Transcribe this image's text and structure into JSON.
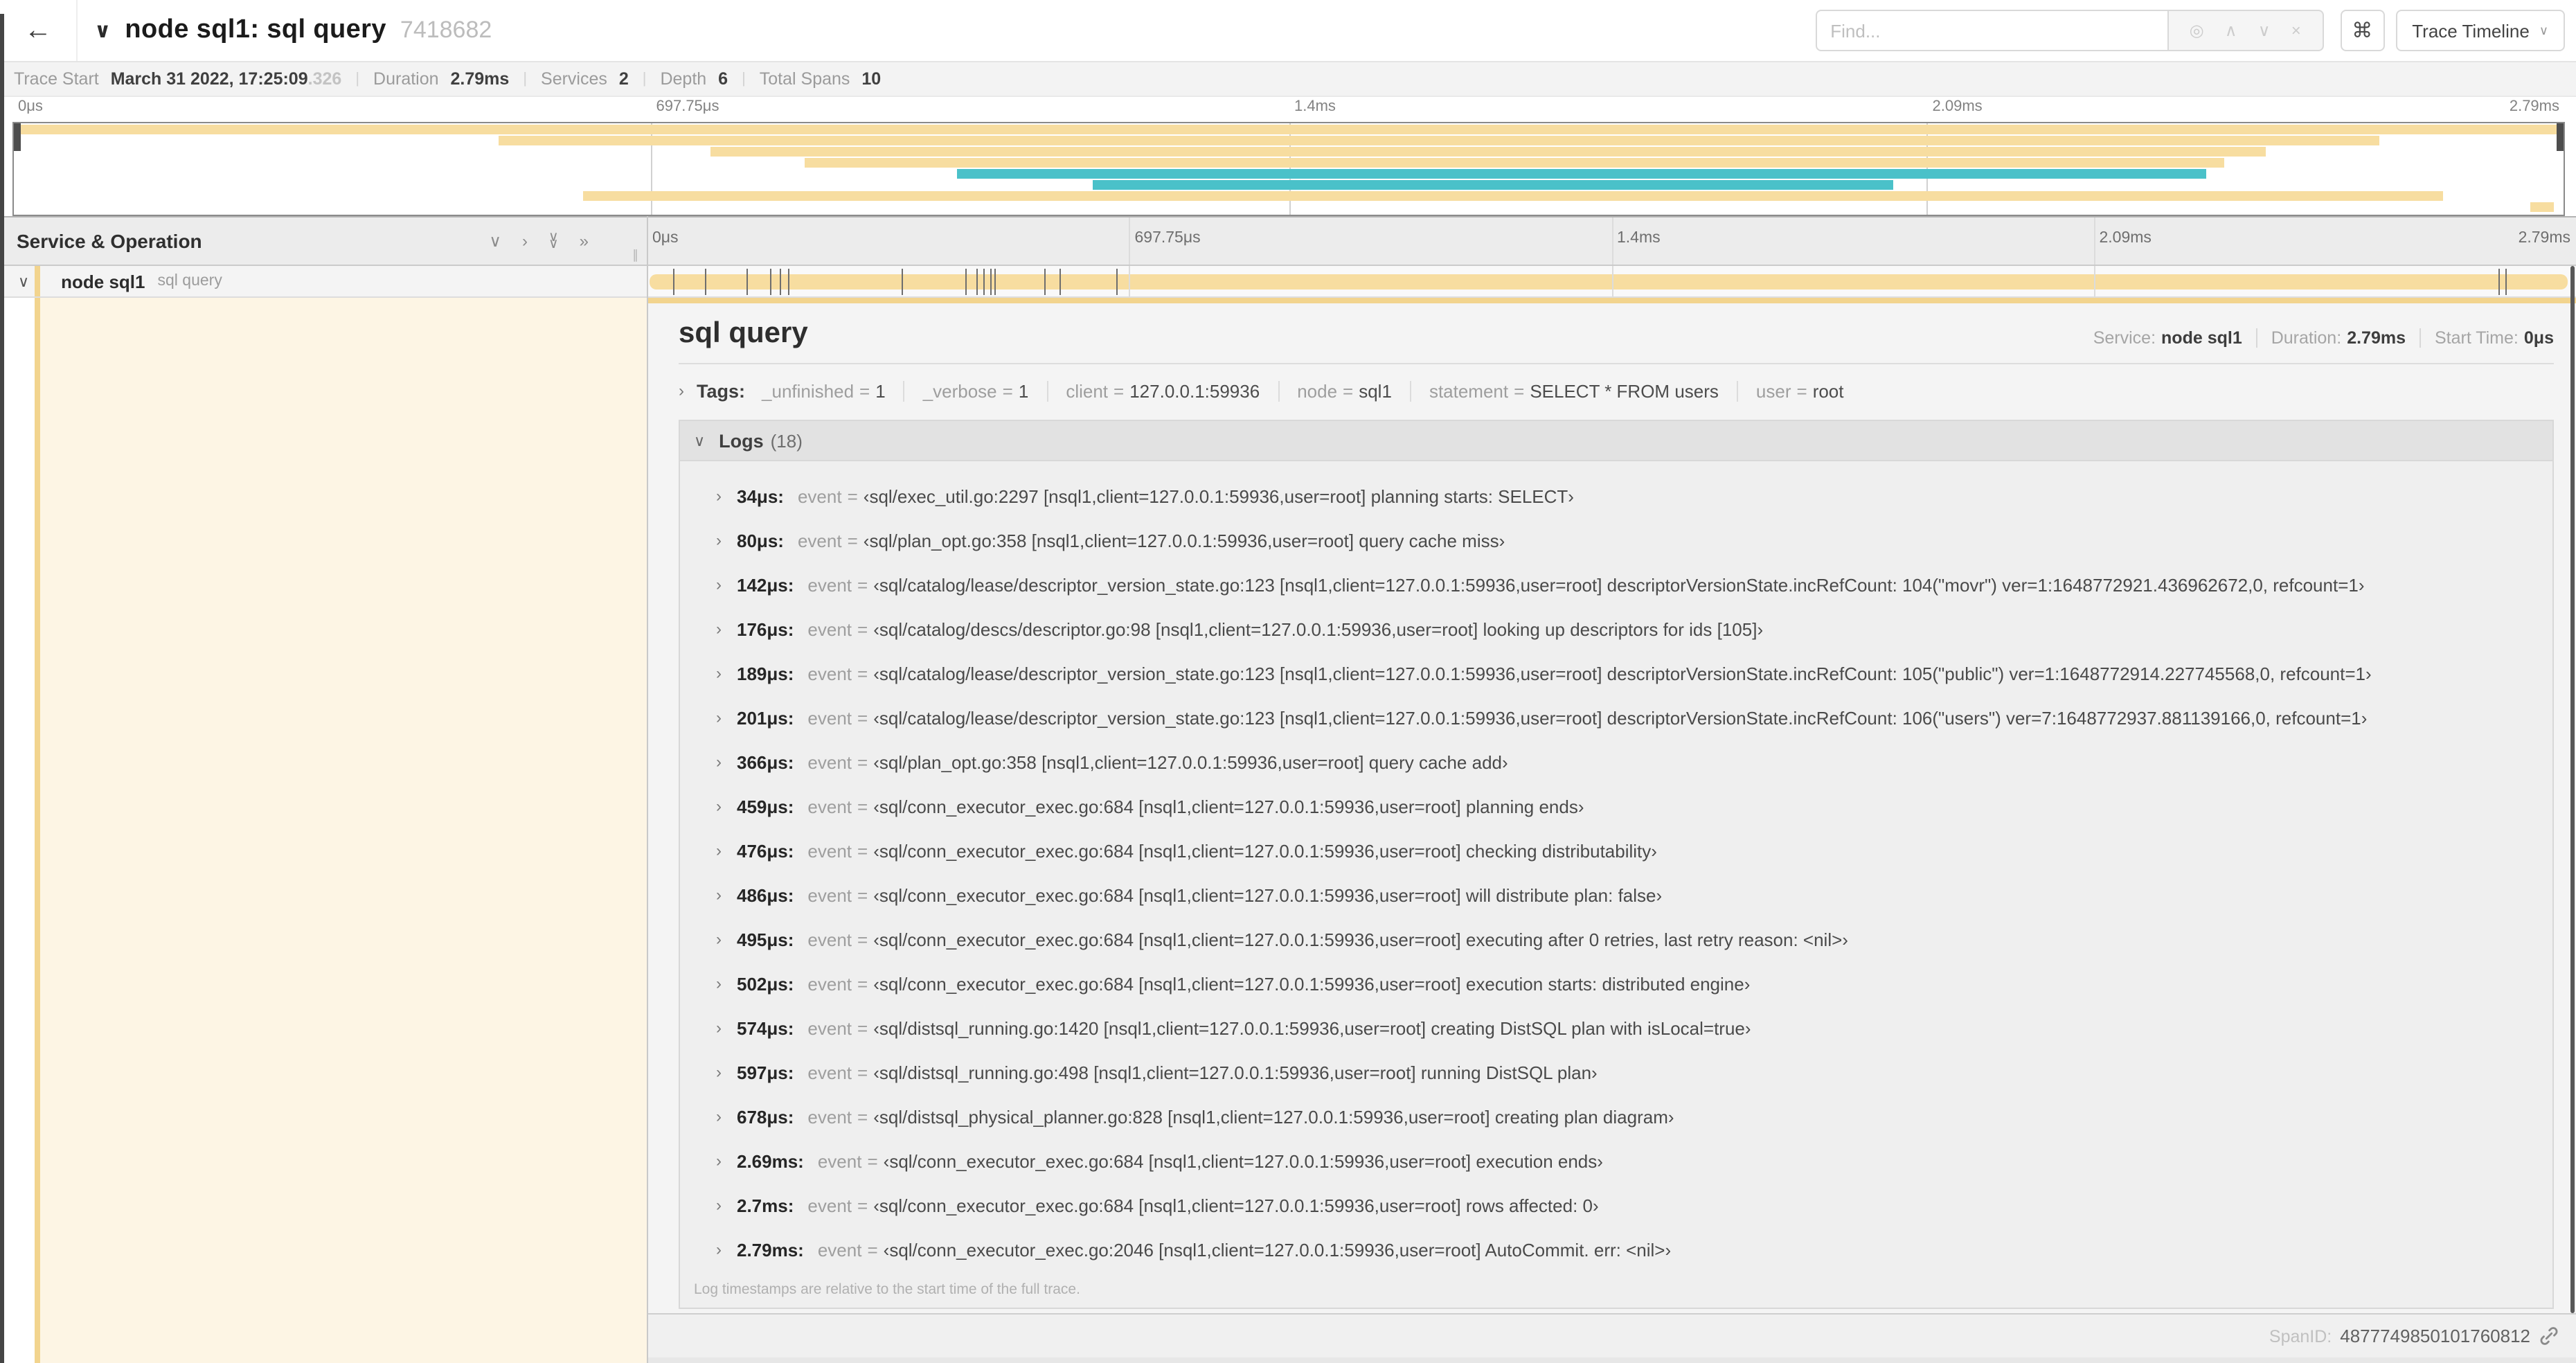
{
  "palette": {
    "span_tan": "#f7dda0",
    "span_teal": "#4ac1c9",
    "accent_tan": "#f2d48e",
    "cream": "#fdf5e4"
  },
  "icons": {
    "back": "←",
    "chevron_down": "∨",
    "chevron_right": "›",
    "double_right": "»",
    "focus": "◎",
    "prev": "∧",
    "next": "∨",
    "clear": "×",
    "shortcut": "⌘",
    "grip": "∥",
    "caret": "∨"
  },
  "header": {
    "title": "node sql1: sql query",
    "trace_id_short": "7418682",
    "find_placeholder": "Find...",
    "view_selector_label": "Trace Timeline"
  },
  "stats": [
    {
      "label": "Trace Start",
      "value": "March 31 2022, 17:25:09",
      "suffix": ".326"
    },
    {
      "label": "Duration",
      "value": "2.79ms"
    },
    {
      "label": "Services",
      "value": "2"
    },
    {
      "label": "Depth",
      "value": "6"
    },
    {
      "label": "Total Spans",
      "value": "10"
    }
  ],
  "timeline": {
    "column_header": "Service & Operation",
    "ticks": [
      "0μs",
      "697.75μs",
      "1.4ms",
      "2.09ms",
      "2.79ms"
    ],
    "tick_pcts": [
      0,
      25,
      50,
      75,
      100
    ]
  },
  "minimap": {
    "bars": [
      {
        "slot": 0,
        "start_pct": 0,
        "end_pct": 100,
        "color": "span_tan"
      },
      {
        "slot": 1,
        "start_pct": 19,
        "end_pct": 92.8,
        "color": "span_tan"
      },
      {
        "slot": 2,
        "start_pct": 27.3,
        "end_pct": 88.3,
        "color": "span_tan"
      },
      {
        "slot": 3,
        "start_pct": 31,
        "end_pct": 86.7,
        "color": "span_tan"
      },
      {
        "slot": 4,
        "start_pct": 37,
        "end_pct": 86,
        "color": "span_teal"
      },
      {
        "slot": 5,
        "start_pct": 42.3,
        "end_pct": 73.7,
        "color": "span_teal"
      },
      {
        "slot": 6,
        "start_pct": 22.3,
        "end_pct": 95.3,
        "color": "span_tan"
      },
      {
        "slot": 7,
        "start_pct": 98.7,
        "end_pct": 99.6,
        "color": "span_tan"
      }
    ]
  },
  "span_row": {
    "service": "node sql1",
    "operation": "sql query",
    "duration_us": 2790,
    "marker_us": [
      34,
      80,
      142,
      176,
      189,
      201,
      366,
      459,
      476,
      486,
      495,
      502,
      574,
      597,
      678,
      2690,
      2700
    ]
  },
  "detail": {
    "title": "sql query",
    "meta": [
      {
        "label": "Service:",
        "value": "node sql1"
      },
      {
        "label": "Duration:",
        "value": "2.79ms"
      },
      {
        "label": "Start Time:",
        "value": "0μs"
      }
    ],
    "tags_title": "Tags:",
    "tags": [
      {
        "key": "_unfinished",
        "value": "1"
      },
      {
        "key": "_verbose",
        "value": "1"
      },
      {
        "key": "client",
        "value": "127.0.0.1:59936"
      },
      {
        "key": "node",
        "value": "sql1"
      },
      {
        "key": "statement",
        "value": "SELECT * FROM users"
      },
      {
        "key": "user",
        "value": "root"
      }
    ],
    "logs_title": "Logs",
    "logs_count": "(18)",
    "logs": [
      {
        "ts": "34μs:",
        "key": "event",
        "value": "‹sql/exec_util.go:2297 [nsql1,client=127.0.0.1:59936,user=root] planning starts: SELECT›"
      },
      {
        "ts": "80μs:",
        "key": "event",
        "value": "‹sql/plan_opt.go:358 [nsql1,client=127.0.0.1:59936,user=root] query cache miss›"
      },
      {
        "ts": "142μs:",
        "key": "event",
        "value": "‹sql/catalog/lease/descriptor_version_state.go:123 [nsql1,client=127.0.0.1:59936,user=root] descriptorVersionState.incRefCount: 104(\"movr\") ver=1:1648772921.436962672,0, refcount=1›"
      },
      {
        "ts": "176μs:",
        "key": "event",
        "value": "‹sql/catalog/descs/descriptor.go:98 [nsql1,client=127.0.0.1:59936,user=root] looking up descriptors for ids [105]›"
      },
      {
        "ts": "189μs:",
        "key": "event",
        "value": "‹sql/catalog/lease/descriptor_version_state.go:123 [nsql1,client=127.0.0.1:59936,user=root] descriptorVersionState.incRefCount: 105(\"public\") ver=1:1648772914.227745568,0, refcount=1›"
      },
      {
        "ts": "201μs:",
        "key": "event",
        "value": "‹sql/catalog/lease/descriptor_version_state.go:123 [nsql1,client=127.0.0.1:59936,user=root] descriptorVersionState.incRefCount: 106(\"users\") ver=7:1648772937.881139166,0, refcount=1›"
      },
      {
        "ts": "366μs:",
        "key": "event",
        "value": "‹sql/plan_opt.go:358 [nsql1,client=127.0.0.1:59936,user=root] query cache add›"
      },
      {
        "ts": "459μs:",
        "key": "event",
        "value": "‹sql/conn_executor_exec.go:684 [nsql1,client=127.0.0.1:59936,user=root] planning ends›"
      },
      {
        "ts": "476μs:",
        "key": "event",
        "value": "‹sql/conn_executor_exec.go:684 [nsql1,client=127.0.0.1:59936,user=root] checking distributability›"
      },
      {
        "ts": "486μs:",
        "key": "event",
        "value": "‹sql/conn_executor_exec.go:684 [nsql1,client=127.0.0.1:59936,user=root] will distribute plan: false›"
      },
      {
        "ts": "495μs:",
        "key": "event",
        "value": "‹sql/conn_executor_exec.go:684 [nsql1,client=127.0.0.1:59936,user=root] executing after 0 retries, last retry reason: <nil>›"
      },
      {
        "ts": "502μs:",
        "key": "event",
        "value": "‹sql/conn_executor_exec.go:684 [nsql1,client=127.0.0.1:59936,user=root] execution starts: distributed engine›"
      },
      {
        "ts": "574μs:",
        "key": "event",
        "value": "‹sql/distsql_running.go:1420 [nsql1,client=127.0.0.1:59936,user=root] creating DistSQL plan with isLocal=true›"
      },
      {
        "ts": "597μs:",
        "key": "event",
        "value": "‹sql/distsql_running.go:498 [nsql1,client=127.0.0.1:59936,user=root] running DistSQL plan›"
      },
      {
        "ts": "678μs:",
        "key": "event",
        "value": "‹sql/distsql_physical_planner.go:828 [nsql1,client=127.0.0.1:59936,user=root] creating plan diagram›"
      },
      {
        "ts": "2.69ms:",
        "key": "event",
        "value": "‹sql/conn_executor_exec.go:684 [nsql1,client=127.0.0.1:59936,user=root] execution ends›"
      },
      {
        "ts": "2.7ms:",
        "key": "event",
        "value": "‹sql/conn_executor_exec.go:684 [nsql1,client=127.0.0.1:59936,user=root] rows affected: 0›"
      },
      {
        "ts": "2.79ms:",
        "key": "event",
        "value": "‹sql/conn_executor_exec.go:2046 [nsql1,client=127.0.0.1:59936,user=root] AutoCommit. err: <nil>›"
      }
    ],
    "footer_note": "Log timestamps are relative to the start time of the full trace.",
    "spanid_label": "SpanID:",
    "spanid_value": "4877749850101760812"
  }
}
